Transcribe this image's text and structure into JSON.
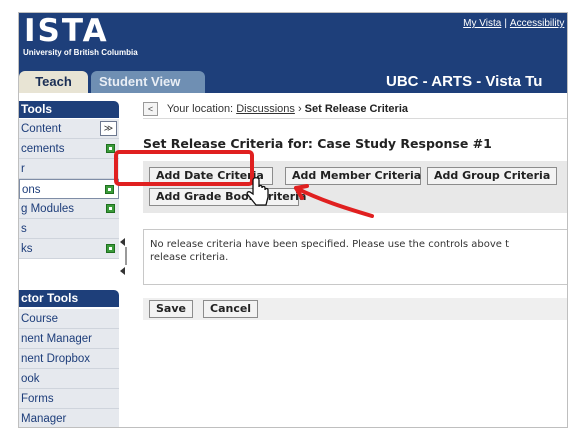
{
  "header": {
    "logo": "ISTA",
    "logo_sub": "University of British Columbia",
    "links": [
      "My Vista",
      "Accessibility"
    ],
    "link_sep": "|",
    "course_title": "UBC - ARTS - Vista Tu",
    "tabs": [
      {
        "label": "Teach",
        "active": true
      },
      {
        "label": "Student View",
        "active": false
      }
    ],
    "tab_student_partial": "dent View",
    "tab_student_prefix": "Stu"
  },
  "sidebar": {
    "tools_heading": "Tools",
    "tools_items": [
      {
        "label": "Content",
        "control": "collapse"
      },
      {
        "label": "cements",
        "control": "add"
      },
      {
        "label": "r",
        "control": "none"
      },
      {
        "label": "ons",
        "control": "add",
        "selected": true
      },
      {
        "label": "g Modules",
        "control": "add"
      },
      {
        "label": "s",
        "control": "none"
      },
      {
        "label": "ks",
        "control": "add"
      }
    ],
    "instructor_heading": "ctor Tools",
    "instructor_items": [
      {
        "label": "Course"
      },
      {
        "label": "nent Manager"
      },
      {
        "label": "nent Dropbox"
      },
      {
        "label": "ook"
      },
      {
        "label": "Forms"
      },
      {
        "label": "Manager"
      }
    ],
    "collapse_glyph": "≫"
  },
  "main": {
    "breadcrumb": {
      "back_glyph": "<",
      "prefix": "Your location:",
      "link": "Discussions",
      "sep": "›",
      "current": "Set Release Criteria"
    },
    "page_title": "Set Release Criteria for: Case Study Response #1",
    "buttons": {
      "add_date": "Add Date Criteria",
      "add_member": "Add Member Criteria",
      "add_group": "Add Group Criteria",
      "add_grade": "Add Grade Book Criteria"
    },
    "message_line1": "No release criteria have been specified. Please use the controls above t",
    "message_line2": "release criteria.",
    "save": "Save",
    "cancel": "Cancel"
  },
  "colors": {
    "header_blue": "#1e3f7a",
    "highlight_red": "#e02020",
    "add_green": "#3a9b3a"
  },
  "icons": {
    "cursor": "hand-pointer-icon",
    "arrow": "red-arrow-annotation"
  }
}
